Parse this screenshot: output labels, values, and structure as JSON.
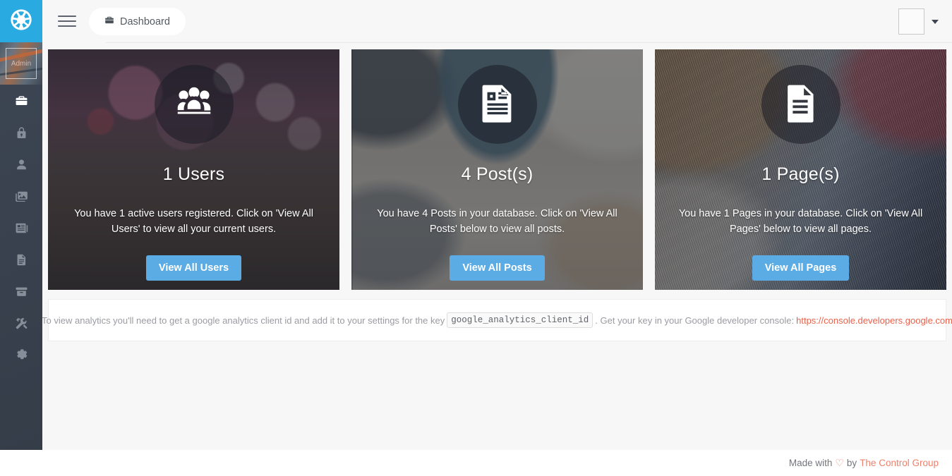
{
  "brand": {
    "logo_icon": "ship-wheel-icon",
    "logo_color": "#29abe2"
  },
  "sidebar": {
    "avatar_alt": "Admin",
    "items": [
      {
        "icon": "briefcase-icon",
        "name": "dashboard",
        "active": true
      },
      {
        "icon": "lock-icon",
        "name": "roles",
        "active": false
      },
      {
        "icon": "user-icon",
        "name": "users",
        "active": false
      },
      {
        "icon": "images-icon",
        "name": "media",
        "active": false
      },
      {
        "icon": "newspaper-icon",
        "name": "posts",
        "active": false
      },
      {
        "icon": "file-text-icon",
        "name": "pages",
        "active": false
      },
      {
        "icon": "archive-icon",
        "name": "modules",
        "active": false
      },
      {
        "icon": "tools-icon",
        "name": "tools",
        "active": false
      },
      {
        "icon": "gear-icon",
        "name": "settings",
        "active": false
      }
    ]
  },
  "header": {
    "menu_toggle_icon": "hamburger-icon",
    "breadcrumb": {
      "icon": "briefcase-icon",
      "label": "Dashboard"
    },
    "profile": {
      "avatar_icon": "avatar-placeholder",
      "caret_icon": "caret-down-icon"
    }
  },
  "cards": [
    {
      "icon": "group-users-icon",
      "title": "1 Users",
      "description": "You have 1 active users registered. Click on 'View All Users' to view all your current users.",
      "button_label": "View All Users",
      "button_color": "#5bace4",
      "bg": "bg-users"
    },
    {
      "icon": "newspaper-icon",
      "title": "4 Post(s)",
      "description": "You have 4 Posts in your database. Click on 'View All Posts' below to view all posts.",
      "button_label": "View All Posts",
      "button_color": "#5bace4",
      "bg": "bg-posts"
    },
    {
      "icon": "file-text-icon",
      "title": "1 Page(s)",
      "description": "You have 1 Pages in your database. Click on 'View All Pages' below to view all pages.",
      "button_label": "View All Pages",
      "button_color": "#5bace4",
      "bg": "bg-pages"
    }
  ],
  "analytics_notice": {
    "text_before": "To view analytics you'll need to get a google analytics client id and add it to your settings for the key",
    "code_key": "google_analytics_client_id",
    "text_after": ". Get your key in your Google developer console:",
    "link_text": "https://console.developers.google.com",
    "link_color": "#e8614a"
  },
  "footer": {
    "made_with": "Made with",
    "heart_icon": "heart-outline-icon",
    "heart_glyph": "♡",
    "by": "by",
    "link_text": "The Control Group",
    "link_color": "#f0806a"
  }
}
